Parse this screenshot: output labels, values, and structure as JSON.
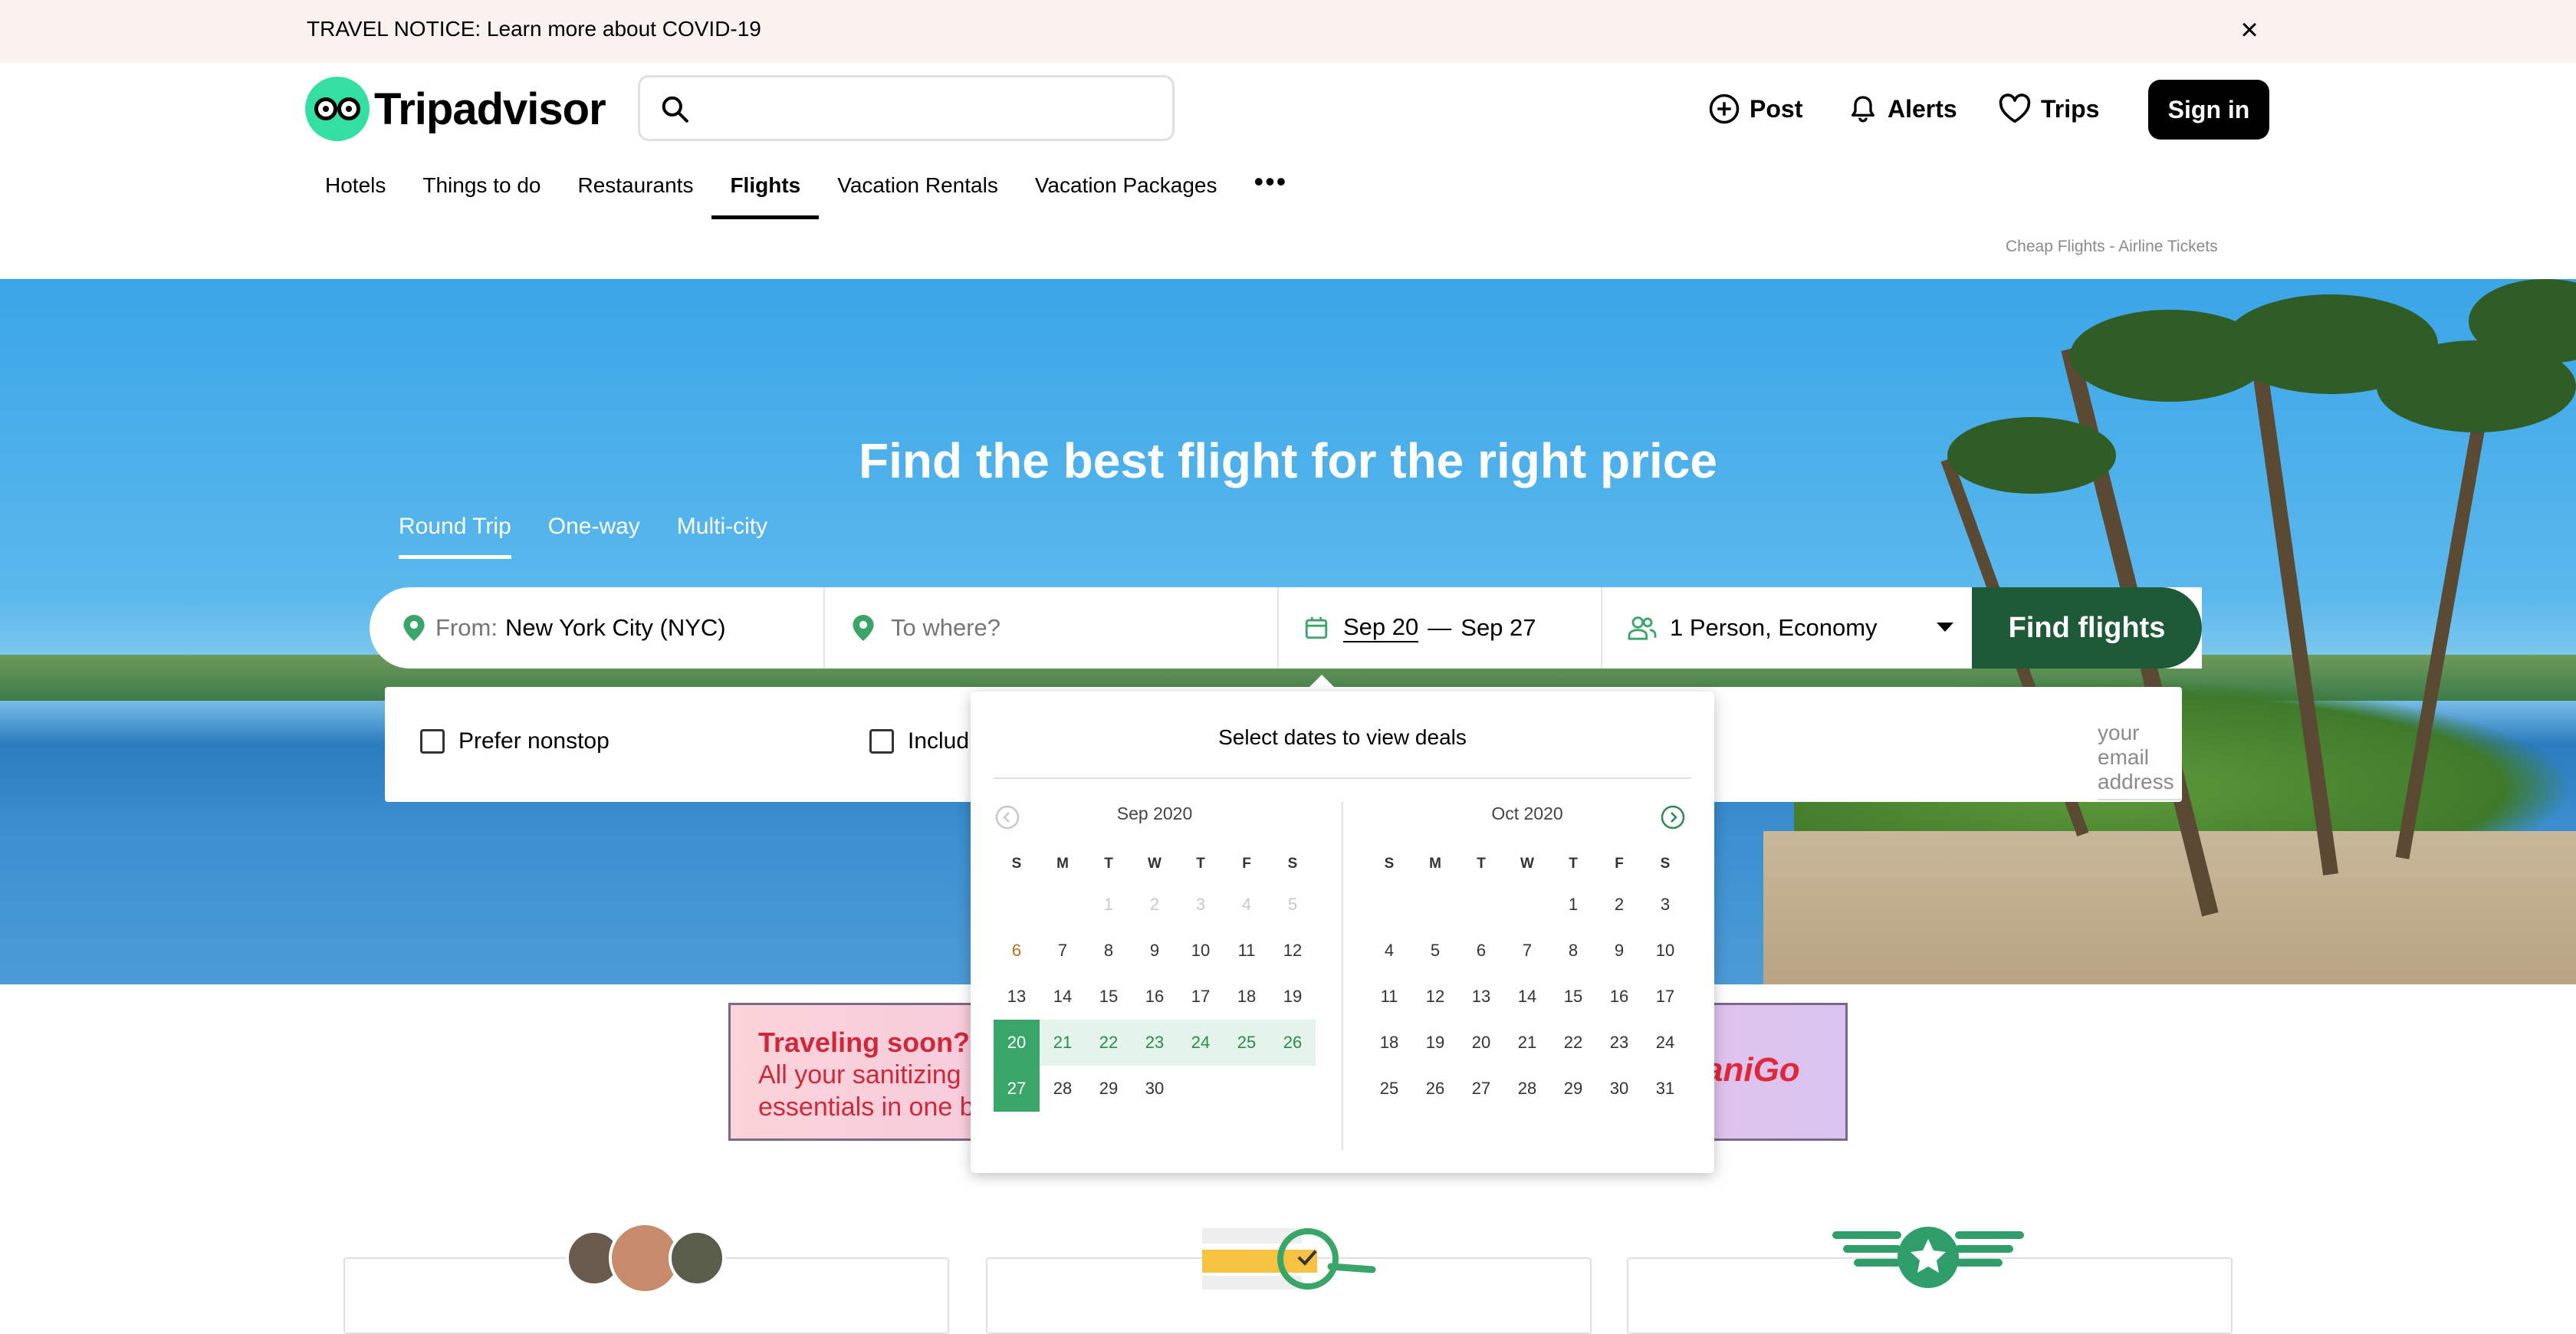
{
  "notice": {
    "text": "TRAVEL NOTICE: Learn more about COVID-19"
  },
  "header": {
    "logo": "Tripadvisor",
    "search": {
      "placeholder": "",
      "value": ""
    },
    "actions": {
      "post": "Post",
      "alerts": "Alerts",
      "trips": "Trips"
    },
    "sign_in": "Sign in"
  },
  "nav": {
    "tabs": [
      "Hotels",
      "Things to do",
      "Restaurants",
      "Flights",
      "Vacation Rentals",
      "Vacation Packages"
    ],
    "active": "Flights",
    "more": "•••"
  },
  "breadcrumb": "Cheap Flights - Airline Tickets",
  "hero": {
    "title": "Find the best flight for the right price",
    "trip_types": [
      "Round Trip",
      "One-way",
      "Multi-city"
    ],
    "active_trip_type": "Round Trip"
  },
  "form": {
    "from_label": "From:",
    "from_value": "New York City (NYC)",
    "to_placeholder": "To where?",
    "date_start": "Sep 20",
    "date_sep": "—",
    "date_end": "Sep 27",
    "travelers": "1 Person, Economy",
    "find_button": "Find flights"
  },
  "options": {
    "nonstop": "Prefer nonstop",
    "include_partial": "Includ",
    "email_placeholder": "your email address"
  },
  "banner": {
    "line1": "Traveling soon?",
    "line2": "All your sanitizing essentials in one b",
    "brand": "aniGo"
  },
  "calendar": {
    "title": "Select dates to view deals",
    "weekdays": [
      "S",
      "M",
      "T",
      "W",
      "T",
      "F",
      "S"
    ],
    "months": [
      {
        "name": "Sep 2020",
        "first_weekday": 2,
        "days": 30,
        "disabled_through": 5,
        "today": 6,
        "range_start": 20,
        "range_end": 27
      },
      {
        "name": "Oct 2020",
        "first_weekday": 4,
        "days": 31
      }
    ]
  },
  "colors": {
    "brand_green": "#34e0a1",
    "find_button": "#1e5a37",
    "selected_day": "#3aa569",
    "range_day": "#e5f4ea"
  }
}
